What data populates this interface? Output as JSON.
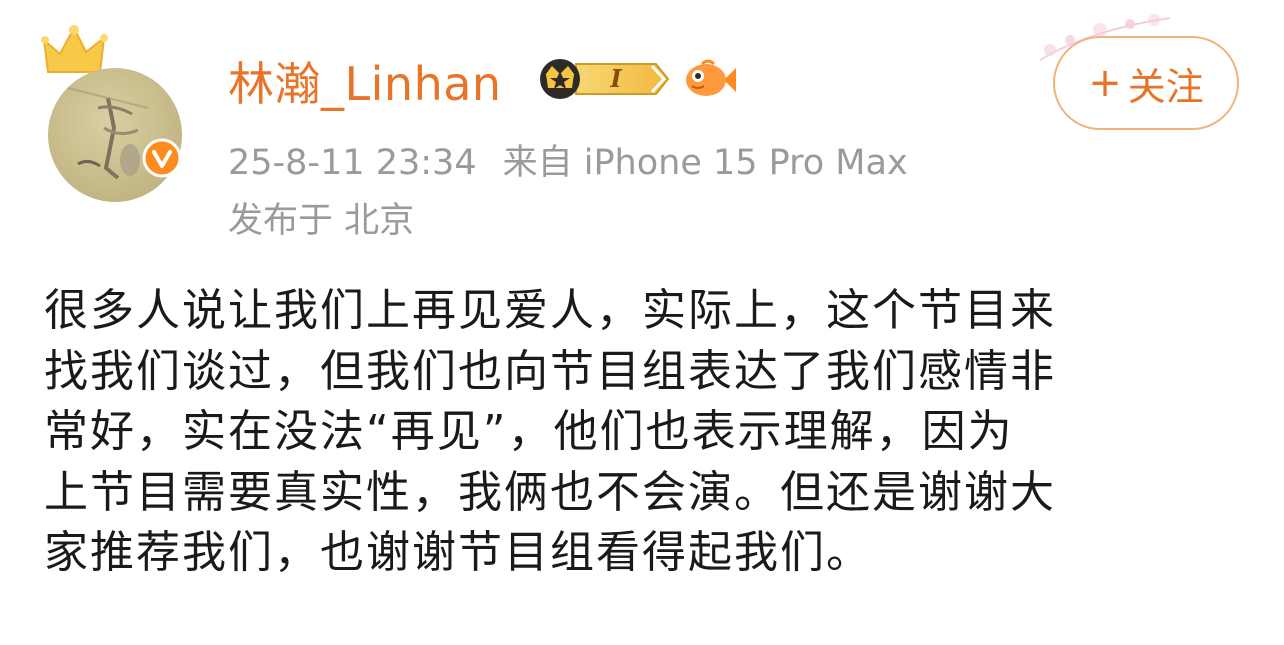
{
  "user": {
    "name": "林瀚_Linhan",
    "vip_level": "I",
    "verified": true
  },
  "post": {
    "date": "25-8-11 23:34",
    "source": "来自 iPhone 15 Pro Max",
    "location": "发布于 北京",
    "lines": [
      "很多人说让我们上再见爱人，实际上，这个节目来",
      "找我们谈过，但我们也向节目组表达了我们感情非",
      "常好，实在没法“再见”，他们也表示理解，因为",
      "上节目需要真实性，我俩也不会演。但还是谢谢大",
      "家推荐我们，也谢谢节目组看得起我们。"
    ]
  },
  "follow_button": {
    "plus": "+",
    "label": "关注"
  },
  "colors": {
    "accent": "#e8742a",
    "meta": "#9a9a9a",
    "text": "#1a1a1a",
    "button_border": "#f0b478"
  },
  "icons": [
    "crown-icon",
    "verified-icon",
    "vip-badge-icon",
    "fish-icon",
    "flower-decoration"
  ]
}
